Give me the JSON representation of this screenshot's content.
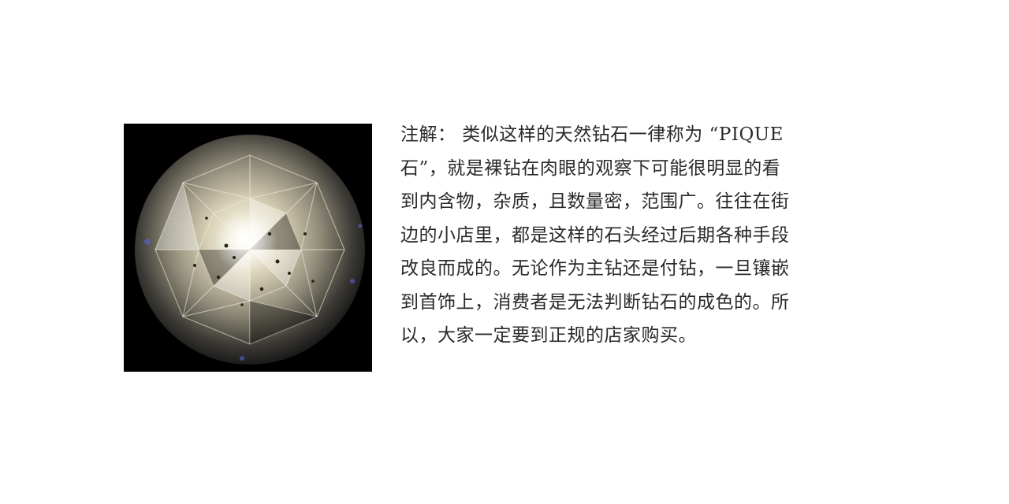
{
  "image": {
    "subject": "diamond-photo",
    "background_color": "#000000"
  },
  "note": {
    "lines": [
      "注解： 类似这样的天然钻石一律称为 “PIQUE",
      "石”，就是裸钻在肉眼的观察下可能很明显的看",
      "到内含物，杂质，且数量密，范围广。往往在街",
      "边的小店里，都是这样的石头经过后期各种手段",
      "改良而成的。无论作为主钻还是付钻，一旦镶嵌",
      "到首饰上，消费者是无法判断钻石的成色的。所",
      "以，大家一定要到正规的店家购买。"
    ]
  }
}
